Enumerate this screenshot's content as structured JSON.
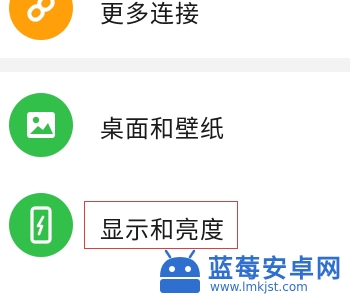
{
  "settings_list": {
    "items": [
      {
        "label": "更多连接",
        "icon": "link-icon",
        "color": "#ff9f0a"
      },
      {
        "label": "桌面和壁纸",
        "icon": "image-icon",
        "color": "#33c04a"
      },
      {
        "label": "显示和亮度",
        "icon": "phone-brightness-icon",
        "color": "#33c04a"
      }
    ]
  },
  "watermark": {
    "title": "蓝莓安卓网",
    "url": "www.lmkjst.com"
  }
}
